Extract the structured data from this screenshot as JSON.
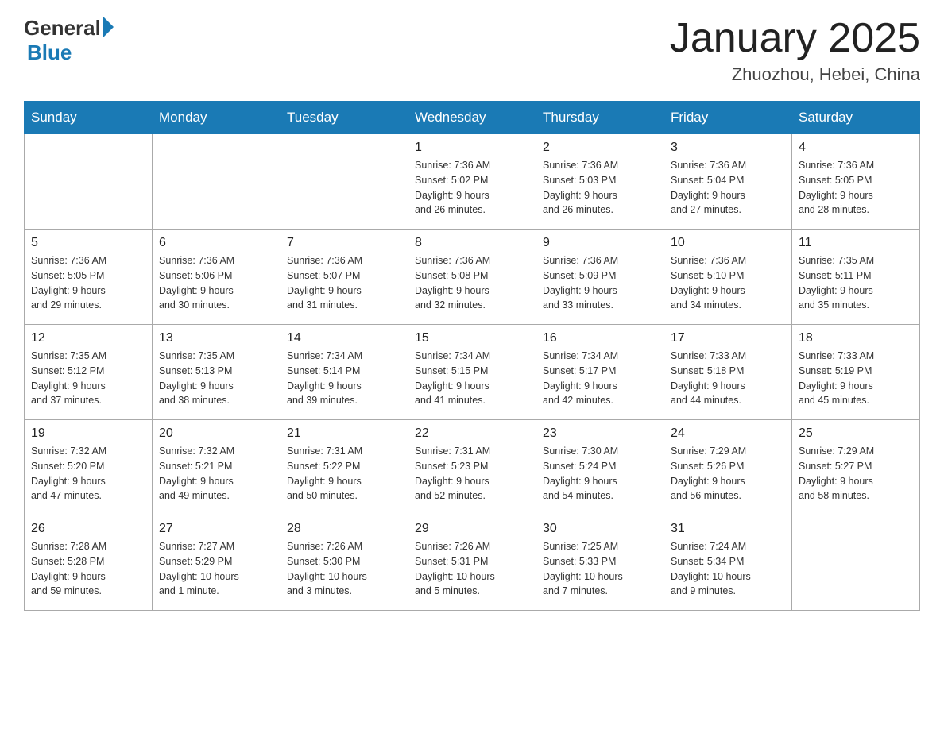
{
  "header": {
    "logo_general": "General",
    "logo_blue": "Blue",
    "title": "January 2025",
    "location": "Zhuozhou, Hebei, China"
  },
  "days_of_week": [
    "Sunday",
    "Monday",
    "Tuesday",
    "Wednesday",
    "Thursday",
    "Friday",
    "Saturday"
  ],
  "weeks": [
    [
      {
        "day": "",
        "info": ""
      },
      {
        "day": "",
        "info": ""
      },
      {
        "day": "",
        "info": ""
      },
      {
        "day": "1",
        "info": "Sunrise: 7:36 AM\nSunset: 5:02 PM\nDaylight: 9 hours\nand 26 minutes."
      },
      {
        "day": "2",
        "info": "Sunrise: 7:36 AM\nSunset: 5:03 PM\nDaylight: 9 hours\nand 26 minutes."
      },
      {
        "day": "3",
        "info": "Sunrise: 7:36 AM\nSunset: 5:04 PM\nDaylight: 9 hours\nand 27 minutes."
      },
      {
        "day": "4",
        "info": "Sunrise: 7:36 AM\nSunset: 5:05 PM\nDaylight: 9 hours\nand 28 minutes."
      }
    ],
    [
      {
        "day": "5",
        "info": "Sunrise: 7:36 AM\nSunset: 5:05 PM\nDaylight: 9 hours\nand 29 minutes."
      },
      {
        "day": "6",
        "info": "Sunrise: 7:36 AM\nSunset: 5:06 PM\nDaylight: 9 hours\nand 30 minutes."
      },
      {
        "day": "7",
        "info": "Sunrise: 7:36 AM\nSunset: 5:07 PM\nDaylight: 9 hours\nand 31 minutes."
      },
      {
        "day": "8",
        "info": "Sunrise: 7:36 AM\nSunset: 5:08 PM\nDaylight: 9 hours\nand 32 minutes."
      },
      {
        "day": "9",
        "info": "Sunrise: 7:36 AM\nSunset: 5:09 PM\nDaylight: 9 hours\nand 33 minutes."
      },
      {
        "day": "10",
        "info": "Sunrise: 7:36 AM\nSunset: 5:10 PM\nDaylight: 9 hours\nand 34 minutes."
      },
      {
        "day": "11",
        "info": "Sunrise: 7:35 AM\nSunset: 5:11 PM\nDaylight: 9 hours\nand 35 minutes."
      }
    ],
    [
      {
        "day": "12",
        "info": "Sunrise: 7:35 AM\nSunset: 5:12 PM\nDaylight: 9 hours\nand 37 minutes."
      },
      {
        "day": "13",
        "info": "Sunrise: 7:35 AM\nSunset: 5:13 PM\nDaylight: 9 hours\nand 38 minutes."
      },
      {
        "day": "14",
        "info": "Sunrise: 7:34 AM\nSunset: 5:14 PM\nDaylight: 9 hours\nand 39 minutes."
      },
      {
        "day": "15",
        "info": "Sunrise: 7:34 AM\nSunset: 5:15 PM\nDaylight: 9 hours\nand 41 minutes."
      },
      {
        "day": "16",
        "info": "Sunrise: 7:34 AM\nSunset: 5:17 PM\nDaylight: 9 hours\nand 42 minutes."
      },
      {
        "day": "17",
        "info": "Sunrise: 7:33 AM\nSunset: 5:18 PM\nDaylight: 9 hours\nand 44 minutes."
      },
      {
        "day": "18",
        "info": "Sunrise: 7:33 AM\nSunset: 5:19 PM\nDaylight: 9 hours\nand 45 minutes."
      }
    ],
    [
      {
        "day": "19",
        "info": "Sunrise: 7:32 AM\nSunset: 5:20 PM\nDaylight: 9 hours\nand 47 minutes."
      },
      {
        "day": "20",
        "info": "Sunrise: 7:32 AM\nSunset: 5:21 PM\nDaylight: 9 hours\nand 49 minutes."
      },
      {
        "day": "21",
        "info": "Sunrise: 7:31 AM\nSunset: 5:22 PM\nDaylight: 9 hours\nand 50 minutes."
      },
      {
        "day": "22",
        "info": "Sunrise: 7:31 AM\nSunset: 5:23 PM\nDaylight: 9 hours\nand 52 minutes."
      },
      {
        "day": "23",
        "info": "Sunrise: 7:30 AM\nSunset: 5:24 PM\nDaylight: 9 hours\nand 54 minutes."
      },
      {
        "day": "24",
        "info": "Sunrise: 7:29 AM\nSunset: 5:26 PM\nDaylight: 9 hours\nand 56 minutes."
      },
      {
        "day": "25",
        "info": "Sunrise: 7:29 AM\nSunset: 5:27 PM\nDaylight: 9 hours\nand 58 minutes."
      }
    ],
    [
      {
        "day": "26",
        "info": "Sunrise: 7:28 AM\nSunset: 5:28 PM\nDaylight: 9 hours\nand 59 minutes."
      },
      {
        "day": "27",
        "info": "Sunrise: 7:27 AM\nSunset: 5:29 PM\nDaylight: 10 hours\nand 1 minute."
      },
      {
        "day": "28",
        "info": "Sunrise: 7:26 AM\nSunset: 5:30 PM\nDaylight: 10 hours\nand 3 minutes."
      },
      {
        "day": "29",
        "info": "Sunrise: 7:26 AM\nSunset: 5:31 PM\nDaylight: 10 hours\nand 5 minutes."
      },
      {
        "day": "30",
        "info": "Sunrise: 7:25 AM\nSunset: 5:33 PM\nDaylight: 10 hours\nand 7 minutes."
      },
      {
        "day": "31",
        "info": "Sunrise: 7:24 AM\nSunset: 5:34 PM\nDaylight: 10 hours\nand 9 minutes."
      },
      {
        "day": "",
        "info": ""
      }
    ]
  ]
}
